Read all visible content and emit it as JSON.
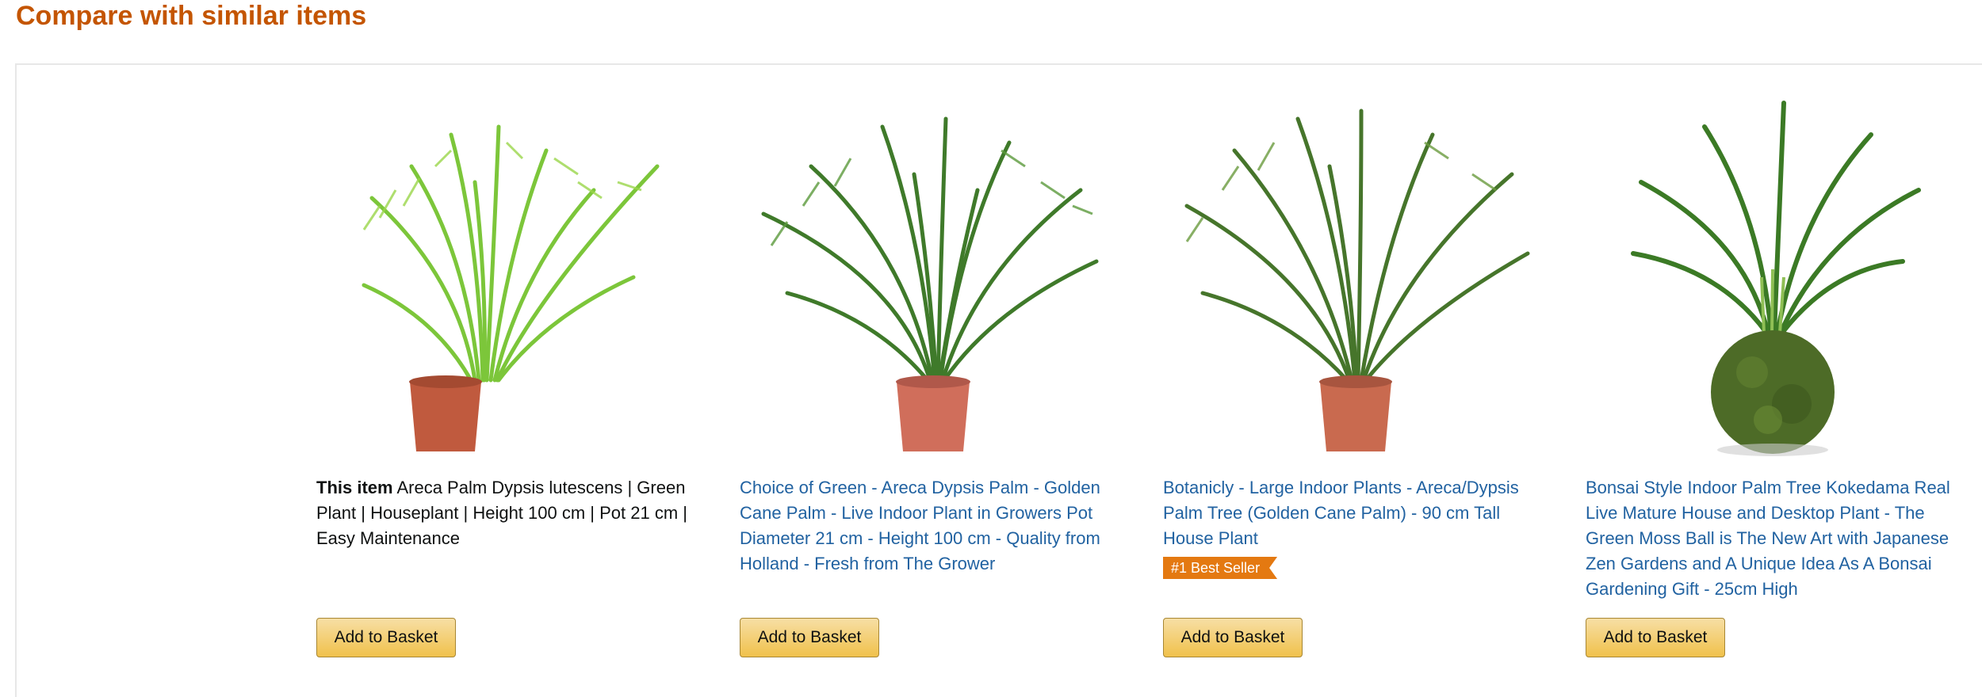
{
  "section": {
    "heading": "Compare with similar items"
  },
  "items": [
    {
      "prefix": "This item",
      "title": " Areca Palm Dypsis lutescens | Green Plant | Houseplant | Height 100 cm | Pot 21 cm | Easy Maintenance",
      "button": "Add to Basket",
      "image_icon": "palm-plant-image"
    },
    {
      "title": "Choice of Green - Areca Dypsis Palm - Golden Cane Palm - Live Indoor Plant in Growers Pot Diameter 21 cm - Height 100 cm - Quality from Holland - Fresh from The Grower",
      "button": "Add to Basket",
      "image_icon": "palm-plant-image"
    },
    {
      "title": "Botanicly - Large Indoor Plants - Areca/Dypsis Palm Tree (Golden Cane Palm) - 90 cm Tall House Plant",
      "badge": "#1 Best Seller",
      "button": "Add to Basket",
      "image_icon": "palm-plant-image"
    },
    {
      "title": "Bonsai Style Indoor Palm Tree Kokedama Real Live Mature House and Desktop Plant - The Green Moss Ball is The New Art with Japanese Zen Gardens and A Unique Idea As A Bonsai Gardening Gift - 25cm High",
      "button": "Add to Basket",
      "image_icon": "kokedama-plant-image"
    }
  ],
  "colors": {
    "heading": "#c45500",
    "link": "#2162a1",
    "badge": "#e47911",
    "button": "#f0c14b"
  }
}
